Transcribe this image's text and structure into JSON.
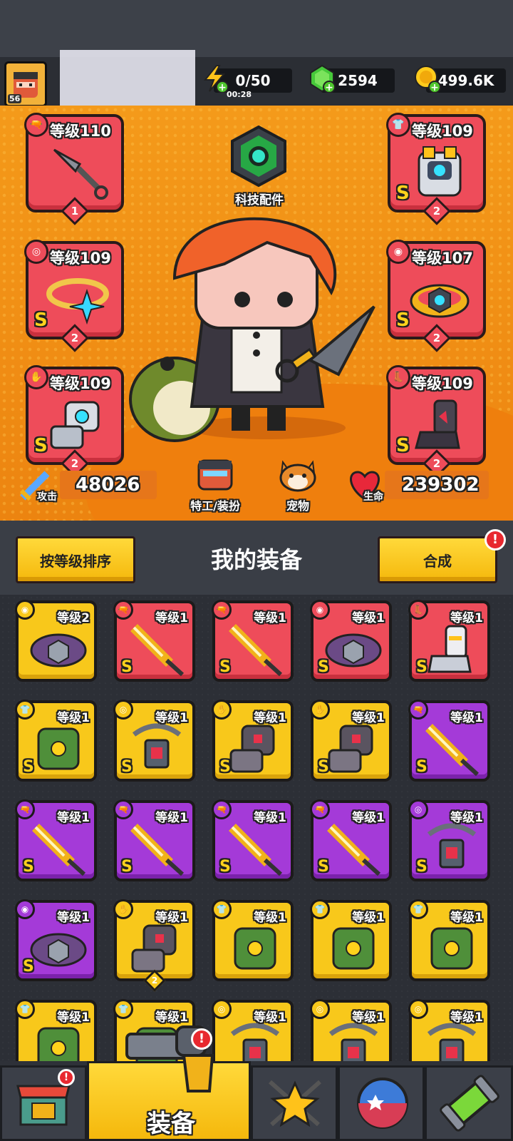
{
  "player": {
    "level": "56"
  },
  "resources": {
    "energy": {
      "value": "0/50",
      "timer": "00:28"
    },
    "gems": {
      "value": "2594"
    },
    "coins": {
      "value": "499.6K"
    }
  },
  "tech": {
    "label": "科技配件"
  },
  "equipped": [
    {
      "slot": "weapon",
      "level": "等级110",
      "stars": "1",
      "grade": ""
    },
    {
      "slot": "armor",
      "level": "等级109",
      "stars": "2",
      "grade": "S"
    },
    {
      "slot": "necklace",
      "level": "等级109",
      "stars": "2",
      "grade": "S"
    },
    {
      "slot": "belt",
      "level": "等级107",
      "stars": "2",
      "grade": "S"
    },
    {
      "slot": "gloves",
      "level": "等级109",
      "stars": "2",
      "grade": "S"
    },
    {
      "slot": "boots",
      "level": "等级109",
      "stars": "2",
      "grade": "S"
    }
  ],
  "stats": {
    "attack_label": "攻击",
    "attack": "48026",
    "hp_label": "生命",
    "hp": "239302"
  },
  "agent_button": {
    "label": "特工/装扮"
  },
  "pet_button": {
    "label": "宠物"
  },
  "inventory": {
    "title": "我的装备",
    "sort_label": "按等级排序",
    "merge_label": "合成",
    "merge_badge": "!",
    "items": [
      {
        "slot": "belt",
        "rarity": "yellow",
        "level": "等级2",
        "grade": ""
      },
      {
        "slot": "weapon",
        "rarity": "red",
        "level": "等级1",
        "grade": "S"
      },
      {
        "slot": "weapon",
        "rarity": "red",
        "level": "等级1",
        "grade": "S"
      },
      {
        "slot": "belt",
        "rarity": "red",
        "level": "等级1",
        "grade": "S"
      },
      {
        "slot": "boots",
        "rarity": "red",
        "level": "等级1",
        "grade": "S"
      },
      {
        "slot": "armor",
        "rarity": "yellow",
        "level": "等级1",
        "grade": "S"
      },
      {
        "slot": "necklace",
        "rarity": "yellow",
        "level": "等级1",
        "grade": "S"
      },
      {
        "slot": "gloves",
        "rarity": "yellow",
        "level": "等级1",
        "grade": "S"
      },
      {
        "slot": "gloves",
        "rarity": "yellow",
        "level": "等级1",
        "grade": "S"
      },
      {
        "slot": "weapon",
        "rarity": "purple",
        "level": "等级1",
        "grade": "S"
      },
      {
        "slot": "weapon",
        "rarity": "purple",
        "level": "等级1",
        "grade": "S"
      },
      {
        "slot": "weapon",
        "rarity": "purple",
        "level": "等级1",
        "grade": "S"
      },
      {
        "slot": "weapon",
        "rarity": "purple",
        "level": "等级1",
        "grade": "S"
      },
      {
        "slot": "weapon",
        "rarity": "purple",
        "level": "等级1",
        "grade": "S"
      },
      {
        "slot": "necklace",
        "rarity": "purple",
        "level": "等级1",
        "grade": "S"
      },
      {
        "slot": "belt",
        "rarity": "purple",
        "level": "等级1",
        "grade": "S"
      },
      {
        "slot": "gloves",
        "rarity": "yellow",
        "level": "等级1",
        "grade": "",
        "stars": "2"
      },
      {
        "slot": "armor",
        "rarity": "yellow",
        "level": "等级1",
        "grade": ""
      },
      {
        "slot": "armor",
        "rarity": "yellow",
        "level": "等级1",
        "grade": ""
      },
      {
        "slot": "armor",
        "rarity": "yellow",
        "level": "等级1",
        "grade": ""
      },
      {
        "slot": "armor",
        "rarity": "yellow",
        "level": "等级1",
        "grade": ""
      },
      {
        "slot": "armor",
        "rarity": "yellow",
        "level": "等级1",
        "grade": ""
      },
      {
        "slot": "necklace",
        "rarity": "yellow",
        "level": "等级1",
        "grade": ""
      },
      {
        "slot": "necklace",
        "rarity": "yellow",
        "level": "等级1",
        "grade": ""
      },
      {
        "slot": "necklace",
        "rarity": "yellow",
        "level": "等级1",
        "grade": ""
      }
    ]
  },
  "nav": {
    "active_label": "装备",
    "shop_badge": "!",
    "equip_badge": "!",
    "items": [
      "shop-icon",
      "gun-icon",
      "star-swords-icon",
      "ball-icon",
      "capsule-icon"
    ]
  },
  "colors": {
    "yellow": "#f8c81b",
    "red": "#ee4c5a",
    "purple": "#a43ad8",
    "hero_bg": "#f49a1a"
  }
}
